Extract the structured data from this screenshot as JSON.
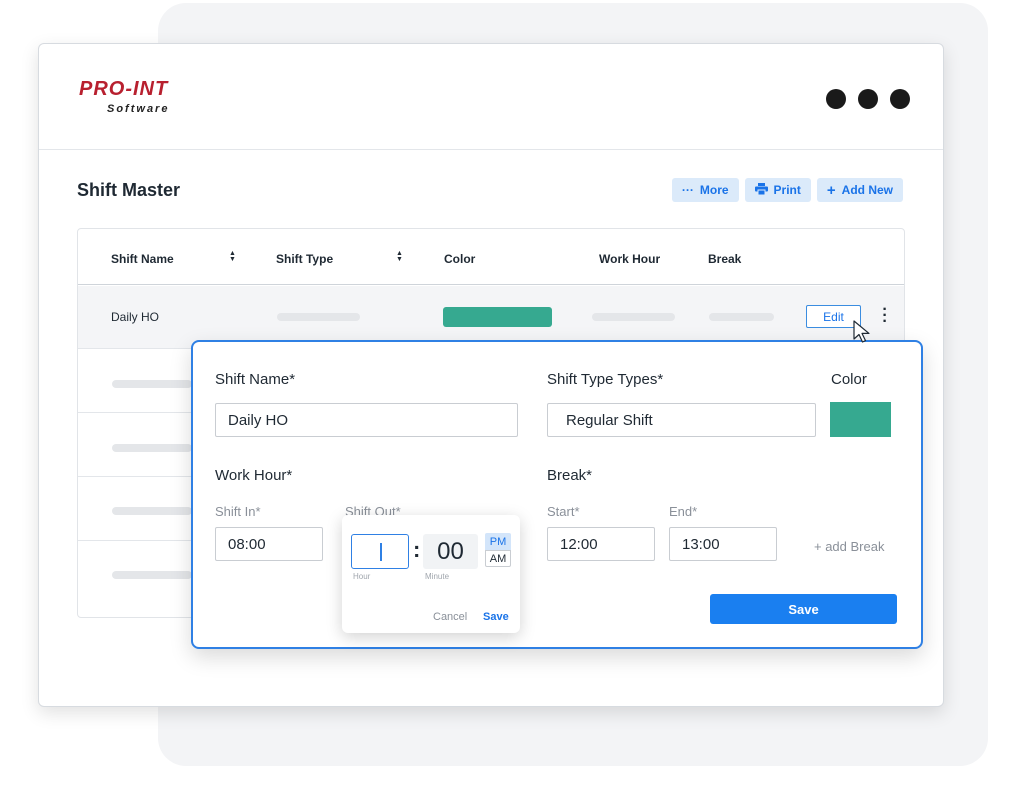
{
  "logo": {
    "main": "PRO-INT",
    "sub": "Software"
  },
  "window_controls": [
    "dot",
    "dot",
    "dot"
  ],
  "page": {
    "title": "Shift Master"
  },
  "toolbar": {
    "more_label": "More",
    "print_label": "Print",
    "add_new_label": "Add New",
    "more_icon": "ellipsis-icon",
    "print_icon": "printer-icon",
    "add_icon": "plus-icon"
  },
  "table": {
    "columns": [
      "Shift Name",
      "Shift Type",
      "Color",
      "Work Hour",
      "Break"
    ],
    "sortable_icon": "sort-icon",
    "rows": [
      {
        "shift_name": "Daily HO",
        "color": "#36a990",
        "action": "Edit"
      }
    ]
  },
  "modal": {
    "shift_name_label": "Shift Name*",
    "shift_name_value": "Daily HO",
    "shift_type_label": "Shift Type Types*",
    "shift_type_value": "Regular Shift",
    "color_label": "Color",
    "color_value": "#36a990",
    "work_hour_label": "Work Hour*",
    "shift_in_label": "Shift In*",
    "shift_in_value": "08:00",
    "shift_out_label": "Shift Out*",
    "break_label": "Break*",
    "start_label": "Start*",
    "start_value": "12:00",
    "end_label": "End*",
    "end_value": "13:00",
    "add_break_label": "+ add Break",
    "save_label": "Save"
  },
  "time_picker": {
    "hour_value": "",
    "minute_value": "00",
    "pm_label": "PM",
    "am_label": "AM",
    "selected_period": "PM",
    "hour_caption": "Hour",
    "minute_caption": "Minute",
    "cancel_label": "Cancel",
    "save_label": "Save"
  },
  "colors": {
    "accent": "#1a7ff0",
    "brand": "#b8202f",
    "shift_color": "#36a990"
  }
}
